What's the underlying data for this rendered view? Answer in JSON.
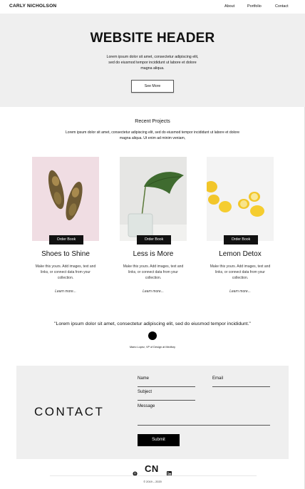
{
  "nav": {
    "brand": "CARLY NICHOLSON",
    "links": [
      "About",
      "Portfolio",
      "Contact"
    ]
  },
  "hero": {
    "title": "WEBSITE HEADER",
    "text": "Lorem ipsum dolor sit amet, consectetur adipiscing elit, sed do eiusmod tempor incididunt ut labore et dolore magna aliqua.",
    "button": "See More"
  },
  "projects": {
    "title": "Recent Projects",
    "description": "Lorem ipsum dolor sit amet, consectetur adipiscing elit, sed do eiusmod tempor incididunt ut labore et dolore magna aliqua. Ut enim ad minim veniam,",
    "cards": [
      {
        "title": "Shoes to Shine",
        "text": "Make this yours. Add images, text and links, or connect data from your collection.",
        "button": "Order Book",
        "more": "Learn more..."
      },
      {
        "title": "Less is More",
        "text": "Make this yours. Add images, text and links, or connect data from your collection.",
        "button": "Order Book",
        "more": "Learn more..."
      },
      {
        "title": "Lemon Detox",
        "text": "Make this yours. Add images, text and links, or connect data from your collection.",
        "button": "Order Book",
        "more": "Learn more..."
      }
    ]
  },
  "testimonial": {
    "quote": "\"Lorem ipsum dolor sit amet, consectetur adipiscing elit, sed do eiusmod tempor incididunt.\"",
    "author": "Mario Lopez, VP of Design at Medfory"
  },
  "contact": {
    "title": "CONTACT",
    "name_label": "Name",
    "email_label": "Email",
    "subject_label": "Subject",
    "message_label": "Message",
    "submit": "Submit"
  },
  "footer": {
    "logo": "CN",
    "copyright": "© 2019 – 2020",
    "icons": [
      "github-icon",
      "linkedin-icon"
    ]
  }
}
